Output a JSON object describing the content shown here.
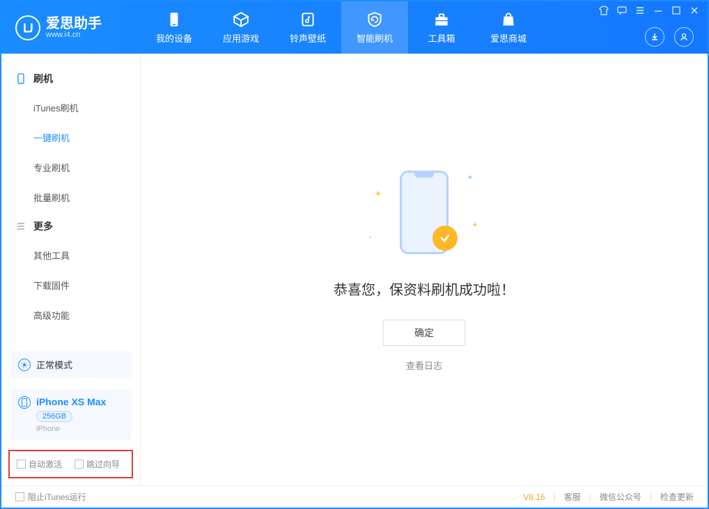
{
  "app": {
    "name": "爱思助手",
    "url": "www.i4.cn"
  },
  "tabs": [
    {
      "label": "我的设备"
    },
    {
      "label": "应用游戏"
    },
    {
      "label": "铃声壁纸"
    },
    {
      "label": "智能刷机"
    },
    {
      "label": "工具箱"
    },
    {
      "label": "爱思商城"
    }
  ],
  "sidebar": {
    "group1": {
      "title": "刷机",
      "items": [
        "iTunes刷机",
        "一键刷机",
        "专业刷机",
        "批量刷机"
      ]
    },
    "group2": {
      "title": "更多",
      "items": [
        "其他工具",
        "下载固件",
        "高级功能"
      ]
    }
  },
  "mode": {
    "label": "正常模式"
  },
  "device": {
    "name": "iPhone XS Max",
    "capacity": "256GB",
    "type": "iPhone"
  },
  "options": {
    "auto_activate": "自动激活",
    "skip_guide": "跳过向导"
  },
  "main": {
    "success_message": "恭喜您，保资料刷机成功啦！",
    "ok_button": "确定",
    "view_log": "查看日志"
  },
  "footer": {
    "block_itunes": "阻止iTunes运行",
    "version": "V8.16",
    "links": [
      "客服",
      "微信公众号",
      "检查更新"
    ]
  }
}
